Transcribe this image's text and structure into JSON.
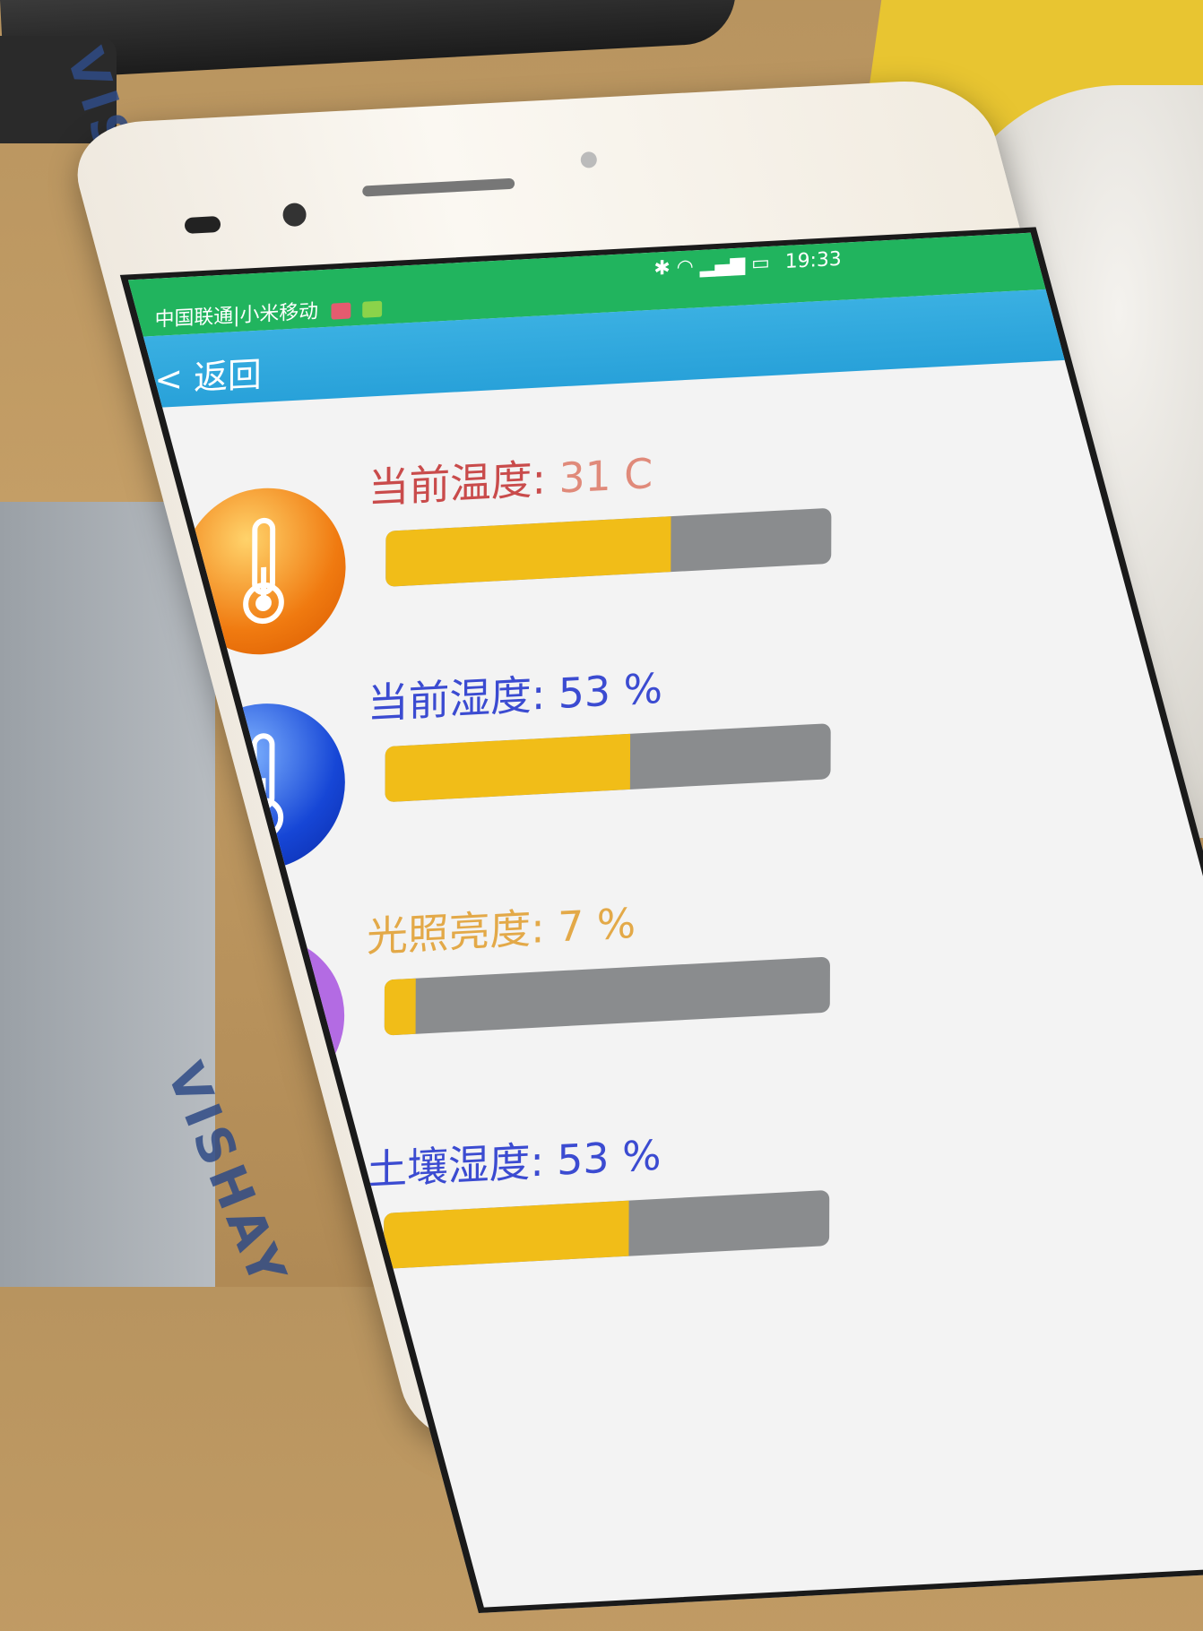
{
  "status_bar": {
    "carrier": "中国联通|小米移动",
    "time": "19:33"
  },
  "nav": {
    "back_label": "< 返回"
  },
  "sensors": [
    {
      "label": "当前温度:",
      "value": "31 C",
      "fill_percent": 64,
      "label_color": "#c94b4b",
      "icon": "thermometer-icon",
      "icon_color": "#f07a10"
    },
    {
      "label": "当前湿度:",
      "value": "53 %",
      "fill_percent": 55,
      "label_color": "#3b4bd1",
      "icon": "thermometer-icon",
      "icon_color": "#1646d6"
    },
    {
      "label": "光照亮度:",
      "value": "7 %",
      "fill_percent": 7,
      "label_color": "#e3a948",
      "icon": "lightbulb-icon",
      "icon_color": "#b36be3"
    },
    {
      "label": "土壤湿度:",
      "value": "53 %",
      "fill_percent": 55,
      "label_color": "#3b4bd1",
      "icon": "thermometer-outline-icon",
      "icon_color": "#111111"
    }
  ],
  "background": {
    "box_text": "VISHAY"
  }
}
